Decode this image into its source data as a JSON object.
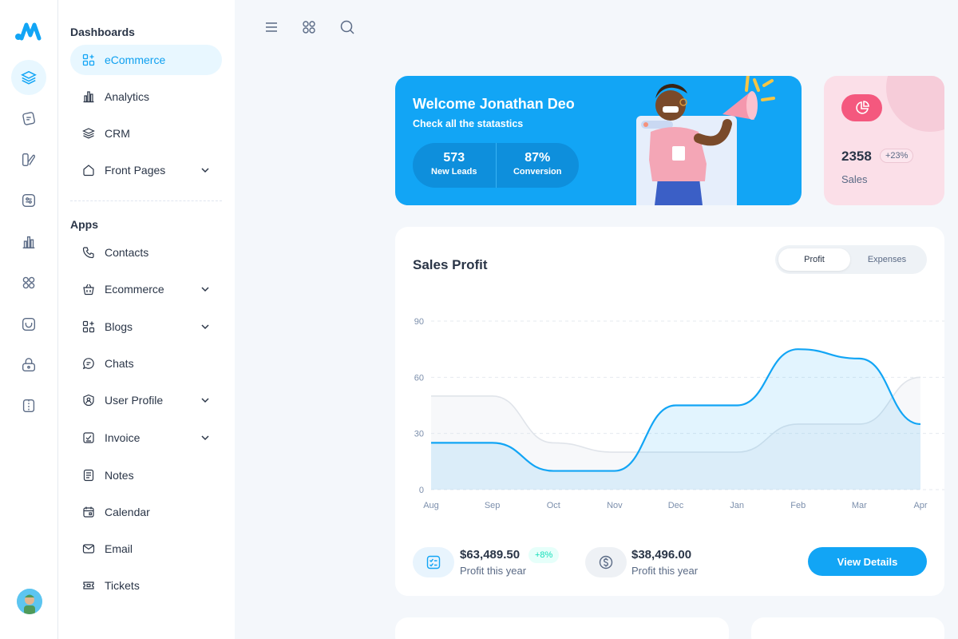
{
  "nav": {
    "dashboards_title": "Dashboards",
    "apps_title": "Apps",
    "items": [
      {
        "label": "eCommerce",
        "icon": "grid-plus-icon"
      },
      {
        "label": "Analytics",
        "icon": "bar-chart-icon"
      },
      {
        "label": "CRM",
        "icon": "layers-icon"
      },
      {
        "label": "Front Pages",
        "icon": "home-icon"
      },
      {
        "label": "Contacts",
        "icon": "phone-icon"
      },
      {
        "label": "Ecommerce",
        "icon": "basket-icon"
      },
      {
        "label": "Blogs",
        "icon": "grid-plus-icon"
      },
      {
        "label": "Chats",
        "icon": "message-icon"
      },
      {
        "label": "User Profile",
        "icon": "user-shield-icon"
      },
      {
        "label": "Invoice",
        "icon": "checklist-icon"
      },
      {
        "label": "Notes",
        "icon": "note-icon"
      },
      {
        "label": "Calendar",
        "icon": "calendar-icon"
      },
      {
        "label": "Email",
        "icon": "mail-icon"
      },
      {
        "label": "Tickets",
        "icon": "ticket-icon"
      }
    ]
  },
  "welcome": {
    "title": "Welcome Jonathan Deo",
    "subtitle": "Check all the statastics",
    "stats": [
      {
        "value": "573",
        "label": "New Leads"
      },
      {
        "value": "87%",
        "label": "Conversion"
      }
    ]
  },
  "sales": {
    "value": "2358",
    "change": "+23%",
    "label": "Sales"
  },
  "profit": {
    "title": "Sales Profit",
    "tabs": [
      "Profit",
      "Expenses"
    ],
    "kpis": [
      {
        "value": "$63,489.50",
        "label": "Profit this year",
        "change": "+8%"
      },
      {
        "value": "$38,496.00",
        "label": "Profit this year"
      }
    ],
    "button": "View Details"
  },
  "chart_data": {
    "type": "area",
    "categories": [
      "Aug",
      "Sep",
      "Oct",
      "Nov",
      "Dec",
      "Jan",
      "Feb",
      "Mar",
      "Apr"
    ],
    "yticks": [
      0,
      30,
      60,
      90
    ],
    "ylim": [
      0,
      90
    ],
    "series": [
      {
        "values": [
          25,
          25,
          10,
          10,
          45,
          45,
          75,
          70,
          35
        ],
        "color": "#12a5f5"
      },
      {
        "values": [
          50,
          50,
          25,
          20,
          20,
          20,
          35,
          35,
          60
        ],
        "color": "#e0e4ea"
      }
    ],
    "grid": true
  },
  "colors": {
    "primary": "#12a5f5",
    "sales_bg": "#fbdfe8",
    "sales_icon": "#f4587e",
    "success": "#13deb9"
  }
}
